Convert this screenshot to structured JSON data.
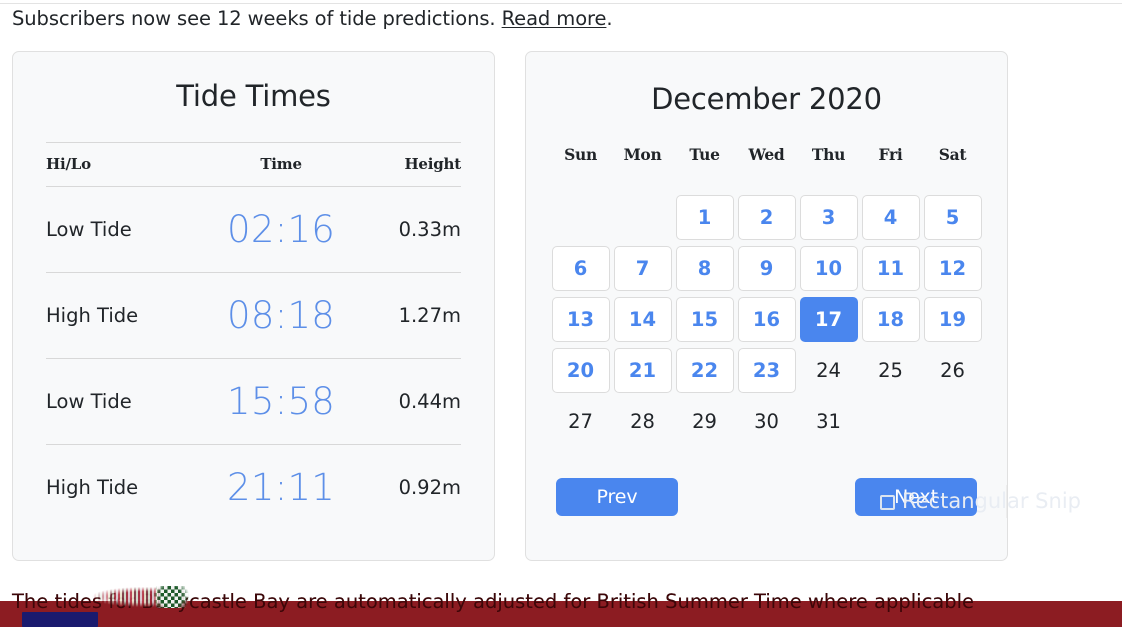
{
  "announcement": {
    "text_before": "Subscribers now see 12 weeks of tide predictions. ",
    "link_label": "Read more",
    "text_after": "."
  },
  "tide_card": {
    "title": "Tide Times",
    "columns": [
      "Hi/Lo",
      "Time",
      "Height"
    ],
    "rows": [
      {
        "hilo": "Low Tide",
        "time": "02:16",
        "height": "0.33m"
      },
      {
        "hilo": "High Tide",
        "time": "08:18",
        "height": "1.27m"
      },
      {
        "hilo": "Low Tide",
        "time": "15:58",
        "height": "0.44m"
      },
      {
        "hilo": "High Tide",
        "time": "21:11",
        "height": "0.92m"
      }
    ]
  },
  "calendar": {
    "title": "December 2020",
    "weekdays": [
      "Sun",
      "Mon",
      "Tue",
      "Wed",
      "Thu",
      "Fri",
      "Sat"
    ],
    "leading_blanks": 2,
    "days": [
      {
        "day": "1",
        "state": "available"
      },
      {
        "day": "2",
        "state": "available"
      },
      {
        "day": "3",
        "state": "available"
      },
      {
        "day": "4",
        "state": "available"
      },
      {
        "day": "5",
        "state": "available"
      },
      {
        "day": "6",
        "state": "available"
      },
      {
        "day": "7",
        "state": "available"
      },
      {
        "day": "8",
        "state": "available"
      },
      {
        "day": "9",
        "state": "available"
      },
      {
        "day": "10",
        "state": "available"
      },
      {
        "day": "11",
        "state": "available"
      },
      {
        "day": "12",
        "state": "available"
      },
      {
        "day": "13",
        "state": "available"
      },
      {
        "day": "14",
        "state": "available"
      },
      {
        "day": "15",
        "state": "available"
      },
      {
        "day": "16",
        "state": "available"
      },
      {
        "day": "17",
        "state": "selected"
      },
      {
        "day": "18",
        "state": "available"
      },
      {
        "day": "19",
        "state": "available"
      },
      {
        "day": "20",
        "state": "available"
      },
      {
        "day": "21",
        "state": "available"
      },
      {
        "day": "22",
        "state": "available"
      },
      {
        "day": "23",
        "state": "available"
      },
      {
        "day": "24",
        "state": "disabled"
      },
      {
        "day": "25",
        "state": "disabled"
      },
      {
        "day": "26",
        "state": "disabled"
      },
      {
        "day": "27",
        "state": "disabled"
      },
      {
        "day": "28",
        "state": "disabled"
      },
      {
        "day": "29",
        "state": "disabled"
      },
      {
        "day": "30",
        "state": "disabled"
      },
      {
        "day": "31",
        "state": "disabled"
      }
    ],
    "prev_label": "Prev",
    "next_label": "Next"
  },
  "overlay": {
    "snip_tool_label": "Rectangular Snip"
  },
  "footer": {
    "note": "The tides for Ballycastle Bay are automatically adjusted for British Summer Time where applicable"
  },
  "colors": {
    "accent_blue": "#4a86ee",
    "time_blue": "#5d8fe8",
    "card_bg": "#f8f9fa",
    "card_border": "#e0e0e0",
    "text": "#212529",
    "band_red": "#8c1c22",
    "navy_chip": "#1a1a6e"
  }
}
